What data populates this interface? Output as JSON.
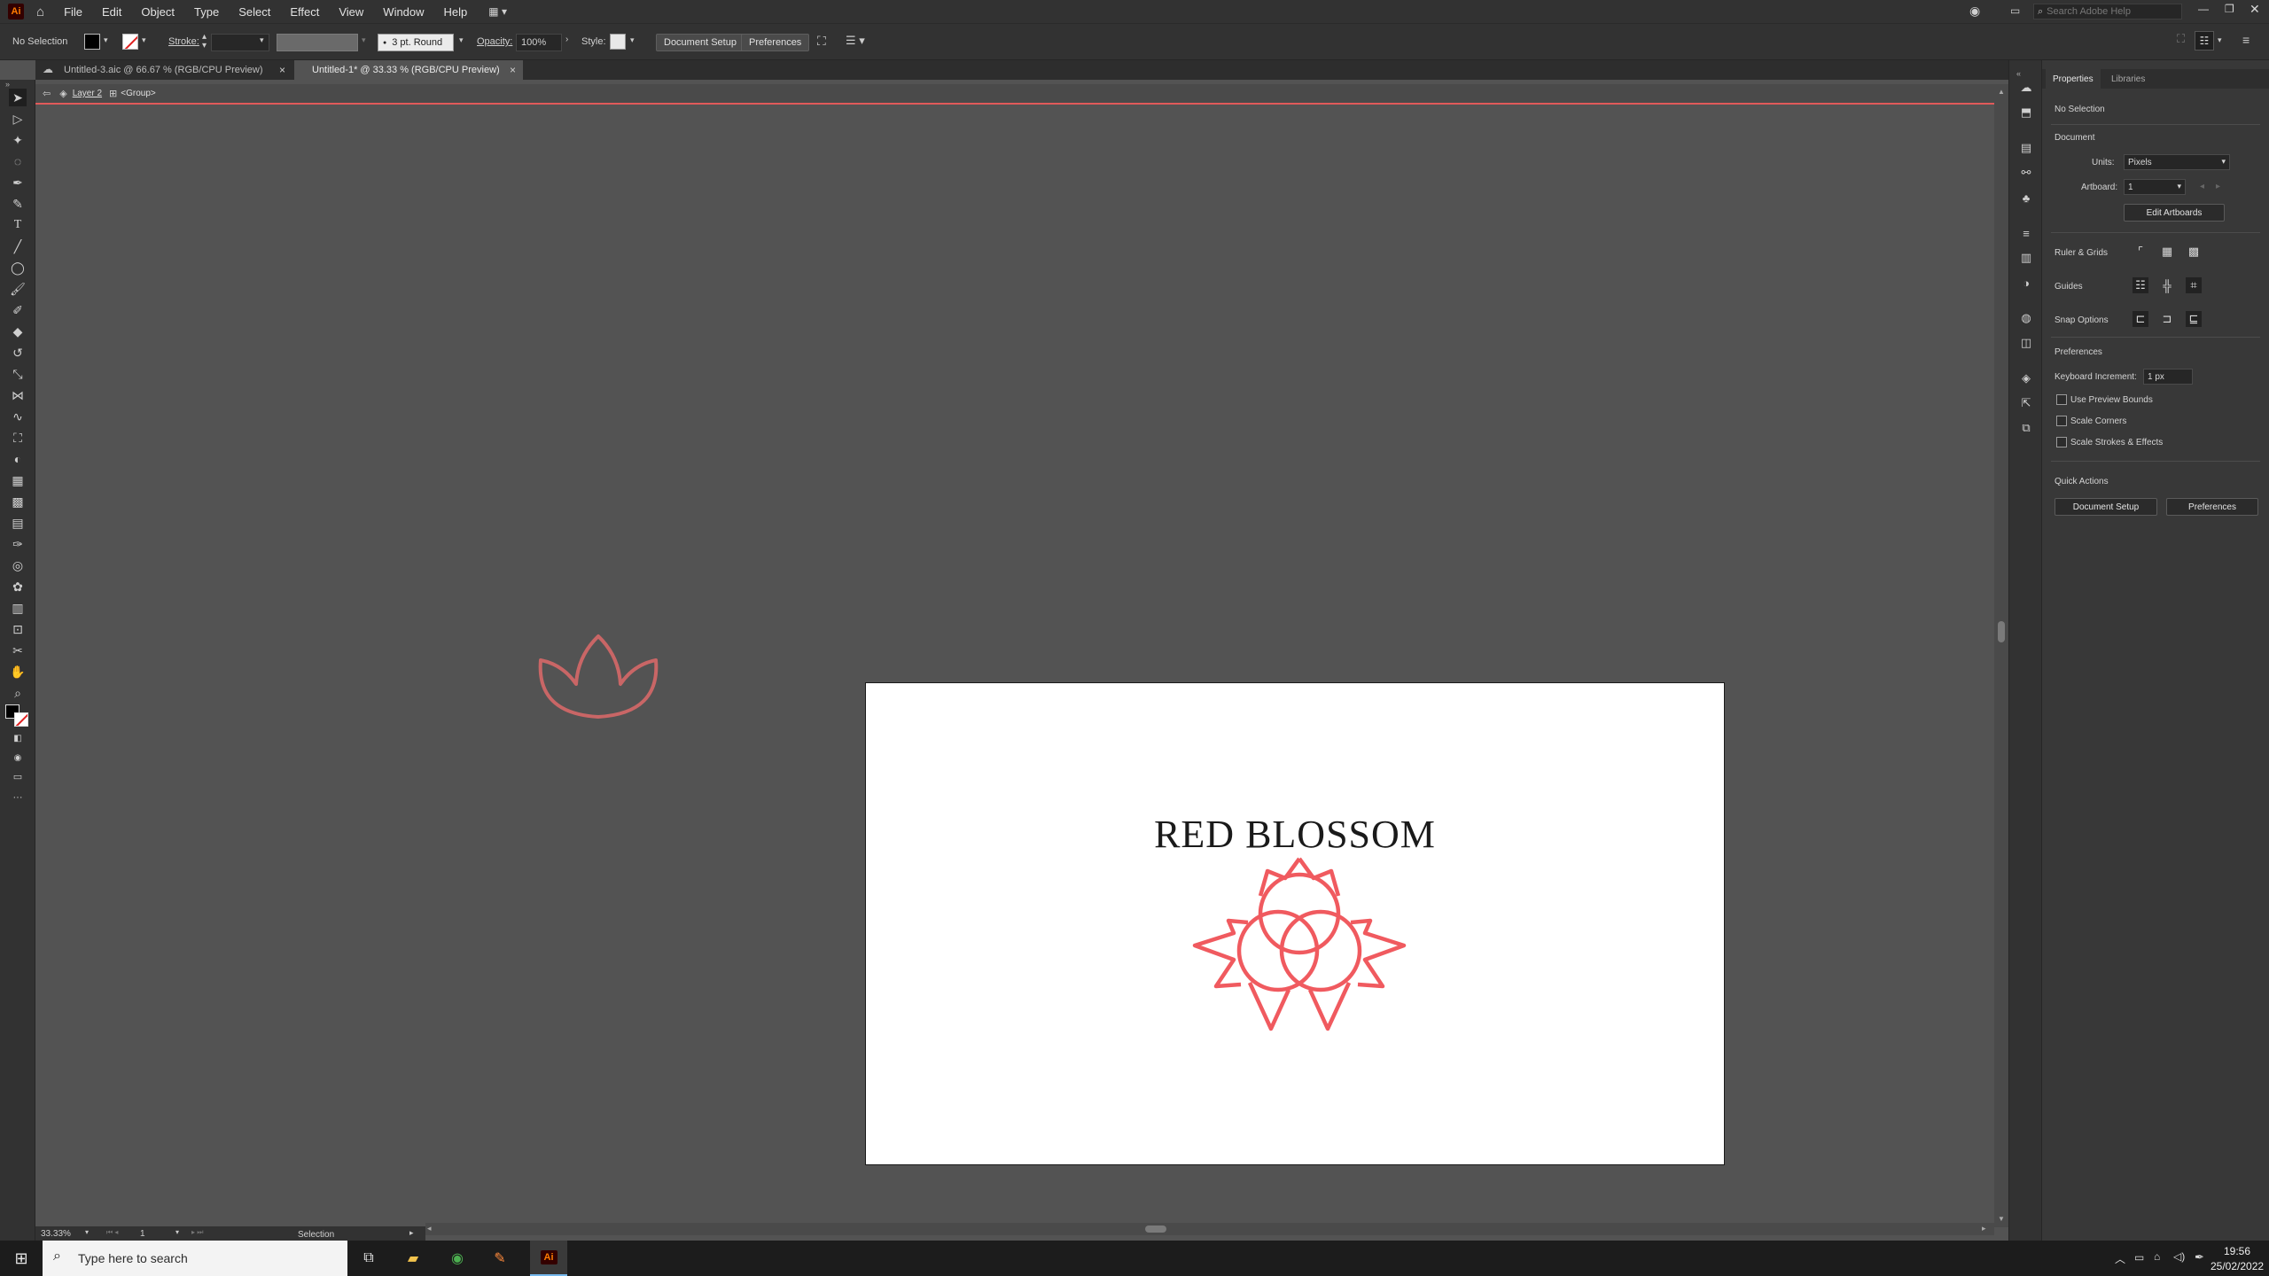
{
  "app": {
    "logo": "Ai",
    "menu": [
      "File",
      "Edit",
      "Object",
      "Type",
      "Select",
      "Effect",
      "View",
      "Window",
      "Help"
    ],
    "search_placeholder": "Search Adobe Help"
  },
  "control_bar": {
    "selection_status": "No Selection",
    "stroke_label": "Stroke:",
    "brush_value": "3 pt. Round",
    "opacity_label": "Opacity:",
    "opacity_value": "100%",
    "style_label": "Style:",
    "document_setup": "Document Setup",
    "preferences": "Preferences"
  },
  "tabs": [
    {
      "label": "Untitled-3.aic @ 66.67 % (RGB/CPU Preview)",
      "close": "×"
    },
    {
      "label": "Untitled-1* @ 33.33 % (RGB/CPU Preview)",
      "close": "×"
    }
  ],
  "breadcrumb": {
    "layer": "Layer 2",
    "group": "<Group>"
  },
  "artboard": {
    "brand_name": "RED BLOSSOM",
    "accent_color": "#f05a5f",
    "ghost_color": "#c96666"
  },
  "status_bar": {
    "zoom": "33.33%",
    "artboard_num": "1",
    "tool": "Selection"
  },
  "panel": {
    "tabs": [
      "Properties",
      "Libraries"
    ],
    "no_selection": "No Selection",
    "document_header": "Document",
    "units_label": "Units:",
    "units_value": "Pixels",
    "artboard_label": "Artboard:",
    "artboard_value": "1",
    "edit_artboards": "Edit Artboards",
    "ruler_grids": "Ruler & Grids",
    "guides": "Guides",
    "snap_options": "Snap Options",
    "preferences_header": "Preferences",
    "keyboard_increment_label": "Keyboard Increment:",
    "keyboard_increment_value": "1 px",
    "use_preview_bounds": "Use Preview Bounds",
    "scale_corners": "Scale Corners",
    "scale_strokes_effects": "Scale Strokes & Effects",
    "quick_actions": "Quick Actions",
    "qa_document_setup": "Document Setup",
    "qa_preferences": "Preferences"
  },
  "taskbar": {
    "search_placeholder": "Type here to search",
    "time": "19:56",
    "date": "25/02/2022"
  }
}
